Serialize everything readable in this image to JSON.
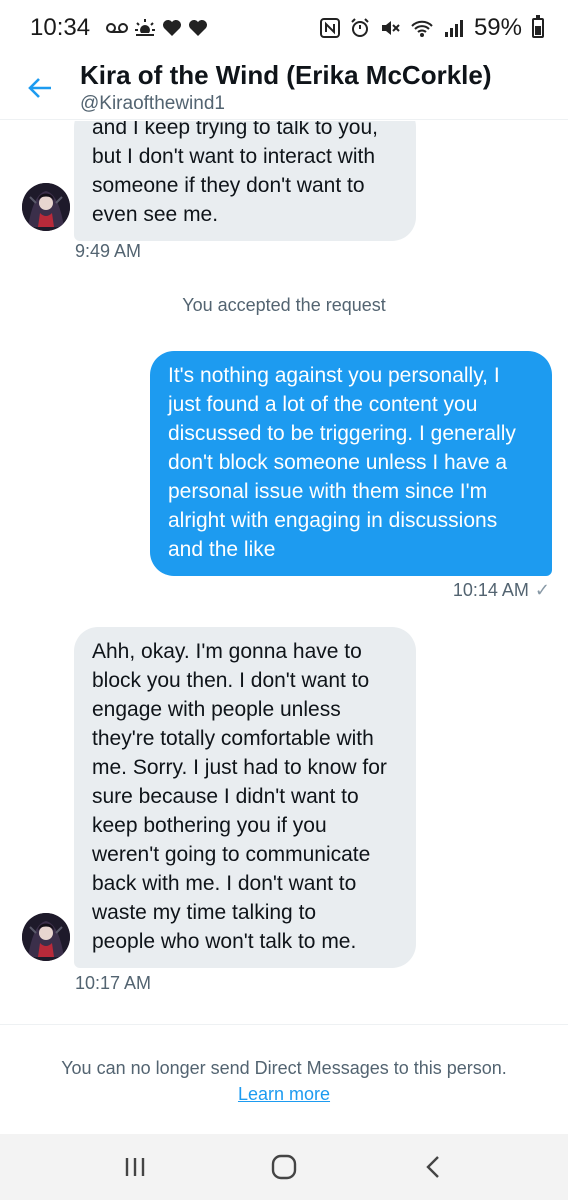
{
  "status_bar": {
    "time": "10:34",
    "battery": "59%",
    "left_icons": [
      "voicemail-icon",
      "weather-icon",
      "heart-icon",
      "heart-icon"
    ],
    "right_icons": [
      "nfc-icon",
      "alarm-icon",
      "mute-icon",
      "wifi-icon",
      "signal-icon",
      "battery-icon"
    ]
  },
  "header": {
    "title": "Kira of the Wind (Erika McCorkle)",
    "handle": "@Kiraofthewind1",
    "back_icon": "back-arrow-icon"
  },
  "messages": [
    {
      "direction": "in",
      "text": "and I keep trying to talk to you,\nbut I don't want to interact with\nsomeone if they don't want to\neven see me.",
      "time": "9:49 AM"
    },
    {
      "direction": "system",
      "text": "You accepted the request"
    },
    {
      "direction": "out",
      "text": "It's nothing against you personally, I\njust found a lot of the content you\ndiscussed to be triggering. I generally\ndon't block someone unless I have a\npersonal issue with them since I'm\nalright with engaging in discussions\nand the like",
      "time": "10:14 AM",
      "read_icon": "check-icon"
    },
    {
      "direction": "in",
      "text": "Ahh, okay. I'm gonna have to\nblock you then. I don't want to\nengage with people unless\nthey're totally comfortable with\nme. Sorry. I just had to know for\nsure because I didn't want to\nkeep bothering you if you\nweren't going to communicate\nback with me. I don't want to\nwaste my time talking to\npeople who won't talk to me.",
      "time": "10:17 AM"
    }
  ],
  "footer": {
    "notice": "You can no longer send Direct Messages to this person.",
    "link": "Learn more"
  },
  "nav_bar": {
    "buttons": [
      "recents-icon",
      "home-icon",
      "back-icon"
    ]
  },
  "colors": {
    "accent": "#1d9bf0",
    "incoming_bubble": "#e9edf0",
    "secondary_text": "#536471"
  }
}
